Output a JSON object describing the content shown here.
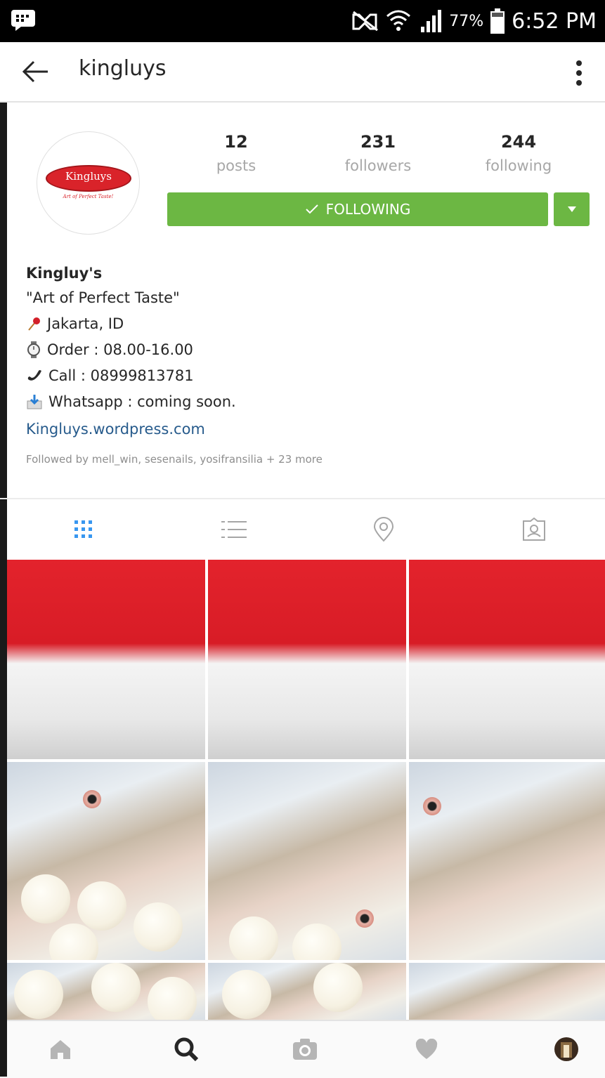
{
  "status_bar": {
    "battery_percent": "77%",
    "time": "6:52 PM"
  },
  "header": {
    "title": "kingluys"
  },
  "profile": {
    "logo_text": "Kingluys",
    "logo_tagline": "Art of Perfect Taste!",
    "stats": [
      {
        "value": "12",
        "label": "posts"
      },
      {
        "value": "231",
        "label": "followers"
      },
      {
        "value": "244",
        "label": "following"
      }
    ],
    "follow_label": "FOLLOWING",
    "accent_color": "#6cb743"
  },
  "bio": {
    "name": "Kingluy's",
    "tagline": "\"Art of Perfect Taste\"",
    "location": "Jakarta, ID",
    "order": "Order : 08.00-16.00",
    "call": "Call : 08999813781",
    "whatsapp": "Whatsapp : coming soon.",
    "website": "Kingluys.wordpress.com",
    "followed_by": "Followed by mell_win, sesenails, yosifransilia + 23 more"
  },
  "tabs": [
    "grid-icon",
    "list-icon",
    "location-icon",
    "tagged-icon"
  ],
  "grid_images": [
    "indonesian flag",
    "indonesian flag",
    "indonesian flag",
    "fish on ice",
    "fish on ice",
    "fish on ice"
  ],
  "bottom_nav": [
    "home-icon",
    "search-icon",
    "camera-icon",
    "heart-icon",
    "profile-avatar"
  ]
}
